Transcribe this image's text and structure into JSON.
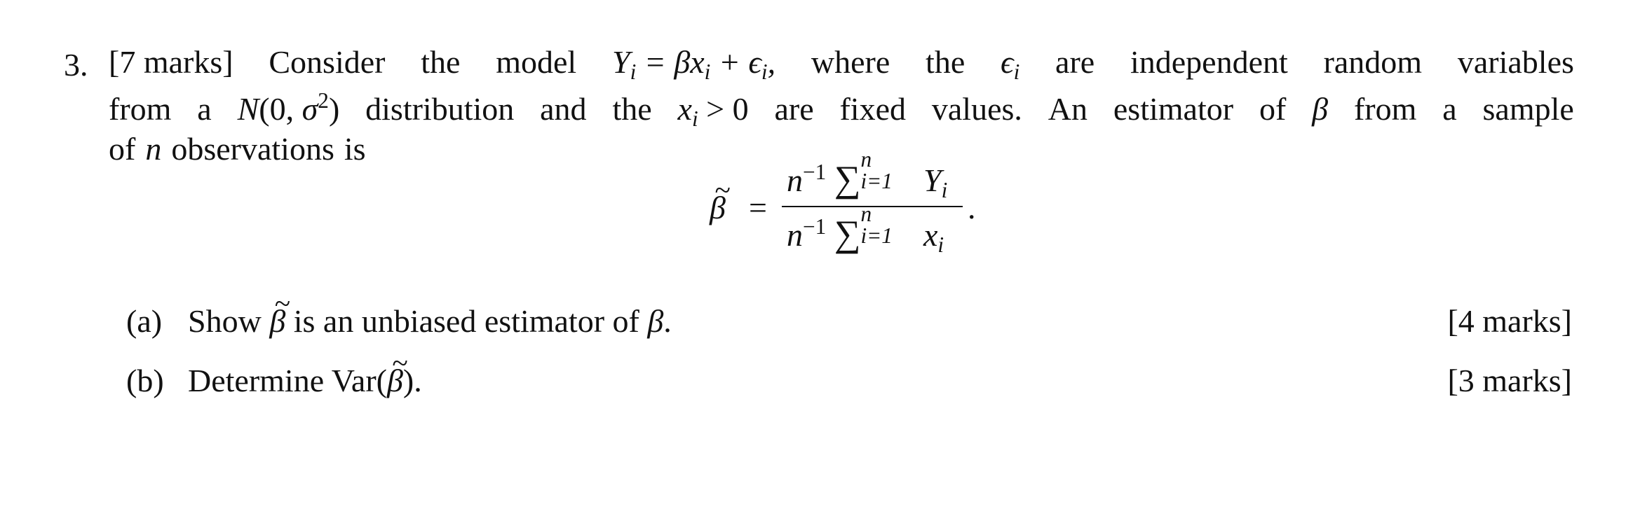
{
  "question": {
    "number": "3.",
    "marks_label": "[7 marks]",
    "lines": [
      [
        "[7",
        "marks]",
        "Consider",
        "the",
        "model",
        "Yᵢ = βxᵢ + ϵᵢ,",
        "where",
        "the",
        "ϵᵢ",
        "are",
        "independent",
        "random",
        "variables"
      ],
      [
        "from",
        "a",
        "N(0, σ²)",
        "distribution",
        "and",
        "the",
        "xᵢ > 0",
        "are",
        "fixed",
        "values.",
        "An",
        "estimator",
        "of",
        "β",
        "from",
        "a",
        "sample"
      ],
      [
        "of",
        "n",
        "observations",
        "is"
      ]
    ],
    "intro_text": "[7 marks] Consider the model Y_i = βx_i + ϵ_i, where the ϵ_i are independent random variables from a N(0, σ²) distribution and the x_i > 0 are fixed values. An estimator of β from a sample of n observations is"
  },
  "formula": {
    "lhs": "β",
    "equals": "=",
    "numerator_prefix": "n",
    "numerator_exp": "−1",
    "sum_symbol": "∑",
    "sum_upper": "n",
    "sum_lower": "i=1",
    "numerator_term": "Y",
    "denominator_prefix": "n",
    "denominator_exp": "−1",
    "denominator_term": "x",
    "index": "i",
    "end_punct": "."
  },
  "parts": [
    {
      "label": "(a)",
      "text_before": "Show",
      "symbol": "β",
      "text_after": "is an unbiased estimator of",
      "symbol2": "β",
      "end": ".",
      "marks": "[4 marks]"
    },
    {
      "label": "(b)",
      "text_before": "Determine Var(",
      "symbol": "β",
      "text_after": ").",
      "marks": "[3 marks]"
    }
  ]
}
